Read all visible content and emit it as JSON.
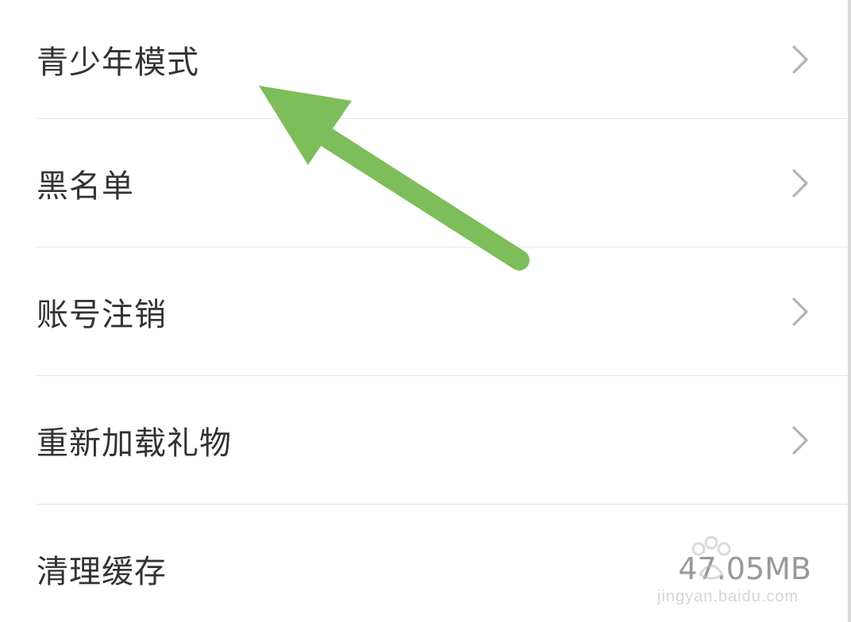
{
  "settings": {
    "items": [
      {
        "label": "青少年模式",
        "icon": "chevron-right-icon"
      },
      {
        "label": "黑名单",
        "icon": "chevron-right-icon"
      },
      {
        "label": "账号注销",
        "icon": "chevron-right-icon"
      },
      {
        "label": "重新加载礼物",
        "icon": "chevron-right-icon"
      },
      {
        "label": "清理缓存",
        "value": "47.05MB"
      }
    ]
  },
  "annotation": {
    "arrow_color": "#7dbd5a",
    "icon": "pointer-arrow-icon"
  },
  "watermark": {
    "subtext": "jingyan.baidu.com",
    "icon": "baidu-paw-logo-icon"
  }
}
